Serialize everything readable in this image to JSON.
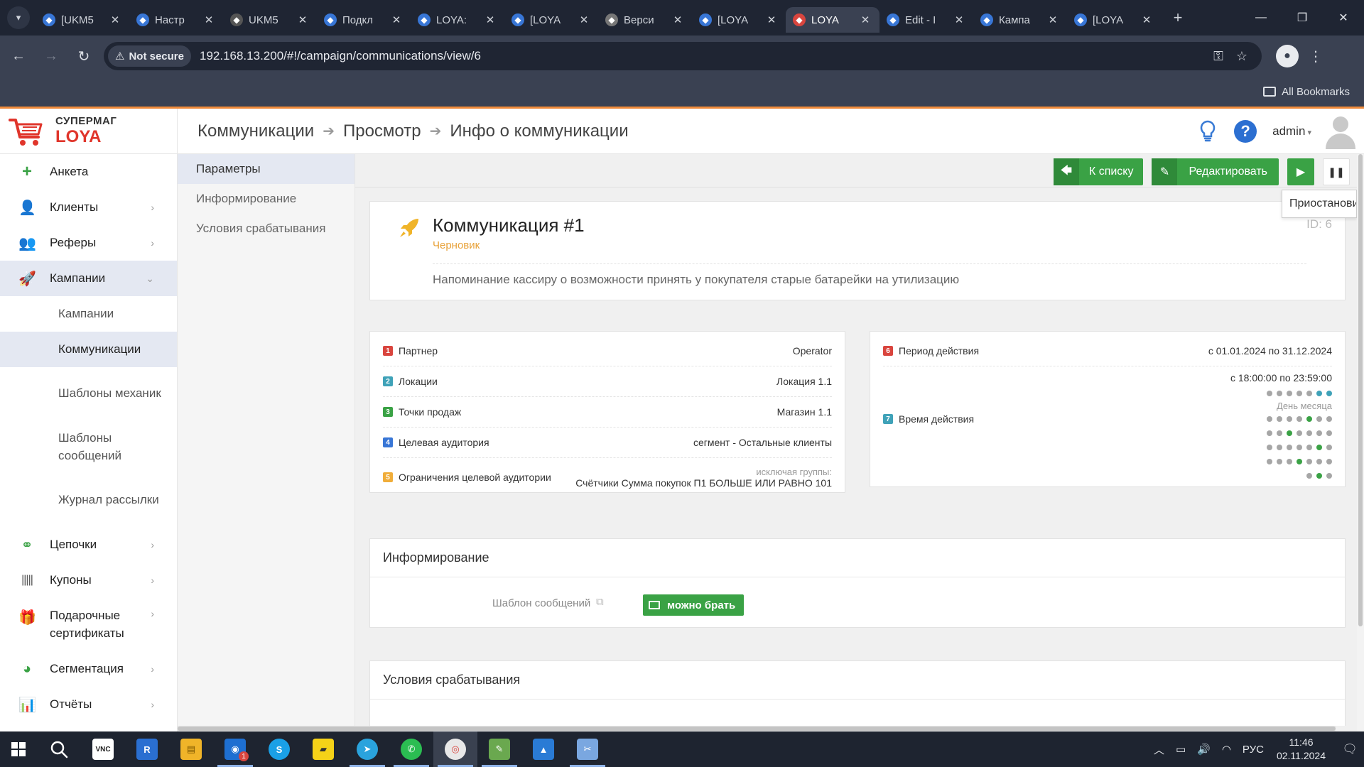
{
  "browser": {
    "tabs": [
      {
        "title": "[UKM5",
        "icon": "jira-icon",
        "color": "#3876d6"
      },
      {
        "title": "Настр",
        "icon": "confluence-icon",
        "color": "#3876d6"
      },
      {
        "title": "UKM5",
        "icon": "cart-icon",
        "color": "#555"
      },
      {
        "title": "Подкл",
        "icon": "jira-icon",
        "color": "#3876d6"
      },
      {
        "title": "LOYA:",
        "icon": "jira-icon",
        "color": "#3876d6"
      },
      {
        "title": "[LOYA",
        "icon": "jira-icon",
        "color": "#3876d6"
      },
      {
        "title": "Верси",
        "icon": "globe-icon",
        "color": "#777"
      },
      {
        "title": "[LOYA",
        "icon": "diamond-icon",
        "color": "#3876d6"
      },
      {
        "title": "LOYA",
        "icon": "loya-icon",
        "color": "#d9453e"
      },
      {
        "title": "Edit - I",
        "icon": "confluence-icon",
        "color": "#3876d6"
      },
      {
        "title": "Кампа",
        "icon": "confluence-icon",
        "color": "#3876d6"
      },
      {
        "title": "[LOYA",
        "icon": "diamond-icon",
        "color": "#3876d6"
      }
    ],
    "active_tab": 8,
    "not_secure_label": "Not secure",
    "url": "192.168.13.200/#!/campaign/communications/view/6",
    "bookmarks_label": "All Bookmarks"
  },
  "app": {
    "logo_line1": "СУПЕРМАГ",
    "logo_line2": "LOYA",
    "breadcrumb": [
      "Коммуникации",
      "Просмотр",
      "Инфо о коммуникации"
    ],
    "user": "admin"
  },
  "sidebar": {
    "items": [
      {
        "label": "Анкета",
        "icon": "plus-icon"
      },
      {
        "label": "Клиенты",
        "icon": "user-icon"
      },
      {
        "label": "Реферы",
        "icon": "users-icon"
      },
      {
        "label": "Кампании",
        "icon": "rocket-icon"
      },
      {
        "label": "Цепочки",
        "icon": "chain-icon"
      },
      {
        "label": "Купоны",
        "icon": "barcode-icon"
      },
      {
        "label": "Подарочные сертификаты",
        "icon": "gift-icon"
      },
      {
        "label": "Сегментация",
        "icon": "pie-icon"
      },
      {
        "label": "Отчёты",
        "icon": "chart-icon"
      }
    ],
    "sub_items": [
      "Кампании",
      "Коммуникации",
      "Шаблоны механик",
      "Шаблоны сообщений",
      "Журнал рассылки"
    ],
    "active_sub": "Коммуникации"
  },
  "subnav": {
    "items": [
      "Параметры",
      "Информирование",
      "Условия срабатывания"
    ],
    "active": 0
  },
  "toolbar": {
    "back_label": "К списку",
    "edit_label": "Редактировать",
    "pause_tooltip": "Приостанови"
  },
  "communication": {
    "title": "Коммуникация #1",
    "status": "Черновик",
    "id_label": "ID: 6",
    "description": "Напоминание кассиру о возможности принять у покупателя старые батарейки на утилизацию"
  },
  "params": [
    {
      "n": "1",
      "label": "Партнер",
      "value": "Operator"
    },
    {
      "n": "2",
      "label": "Локации",
      "value": "Локация 1.1"
    },
    {
      "n": "3",
      "label": "Точки продаж",
      "value": "Магазин 1.1"
    },
    {
      "n": "4",
      "label": "Целевая аудитория",
      "value": "сегмент - Остальные клиенты"
    },
    {
      "n": "5",
      "label": "Ограничения целевой аудитории",
      "value_hint": "исключая группы:",
      "value": "Счётчики Сумма покупок П1 БОЛЬШЕ ИЛИ РАВНО 101"
    }
  ],
  "period": {
    "n6": "6",
    "period_label": "Период действия",
    "period_value": "с 01.01.2024 по 31.12.2024",
    "n7": "7",
    "time_label": "Время действия",
    "time_value": "с 18:00:00 по 23:59:00",
    "weekday_dots": [
      0,
      0,
      0,
      0,
      0,
      1,
      1
    ],
    "day_of_month_label": "День месяца",
    "month_dots": [
      [
        0,
        0,
        0,
        0,
        1,
        0,
        0
      ],
      [
        0,
        0,
        1,
        0,
        0,
        0,
        0
      ],
      [
        0,
        0,
        0,
        0,
        0,
        1,
        0
      ],
      [
        0,
        0,
        0,
        1,
        0,
        0,
        0
      ],
      [
        0,
        1,
        0
      ]
    ]
  },
  "inform": {
    "title": "Информирование",
    "template_label": "Шаблон сообщений",
    "template_value": "можно брать"
  },
  "conditions": {
    "title": "Условия срабатывания"
  },
  "taskbar": {
    "apps": [
      "VNC",
      "R",
      "Explorer",
      "Outlook",
      "Skype",
      "Sticky",
      "Telegram",
      "WhatsApp",
      "Chrome",
      "Editor",
      "Photos",
      "Snip"
    ],
    "lang": "РУС",
    "time": "11:46",
    "date": "02.11.2024",
    "outlook_badge": "1"
  }
}
